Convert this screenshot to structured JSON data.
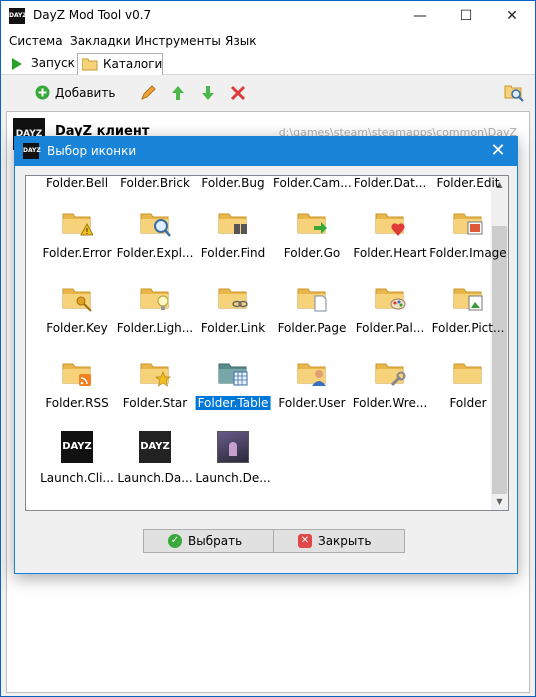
{
  "app": {
    "title": "DayZ Mod Tool  v0.7",
    "icon_text": "DAYZ"
  },
  "menu": [
    "Система",
    "Закладки",
    "Инструменты",
    "Язык"
  ],
  "tabs": [
    {
      "label": "Запуск",
      "icon": "play-icon"
    },
    {
      "label": "Каталоги",
      "icon": "folder-open-icon"
    }
  ],
  "toolbar": {
    "add_label": "Добавить",
    "icons": [
      "add-icon",
      "edit-icon",
      "arrow-up-icon",
      "arrow-down-icon",
      "delete-icon",
      "folder-search-icon"
    ]
  },
  "main_list": {
    "row_title": "DayZ клиент",
    "row_path": "d:\\games\\steam\\steamapps\\common\\DayZ"
  },
  "dialog": {
    "title": "Выбор иконки",
    "top_row": [
      "Folder.Bell",
      "Folder.Brick",
      "Folder.Bug",
      "Folder.Cam...",
      "Folder.Dat...",
      "Folder.Edit"
    ],
    "rows": [
      [
        "Folder.Error",
        "Folder.Expl...",
        "Folder.Find",
        "Folder.Go",
        "Folder.Heart",
        "Folder.Image"
      ],
      [
        "Folder.Key",
        "Folder.Ligh...",
        "Folder.Link",
        "Folder.Page",
        "Folder.Pal...",
        "Folder.Pict..."
      ],
      [
        "Folder.RSS",
        "Folder.Star",
        "Folder.Table",
        "Folder.User",
        "Folder.Wre...",
        "Folder"
      ],
      [
        "Launch.Cli...",
        "Launch.Da...",
        "Launch.De..."
      ]
    ],
    "selected": "Folder.Table",
    "select_label": "Выбрать",
    "close_label": "Закрыть"
  },
  "colors": {
    "accent": "#1883d7",
    "selection": "#0078d7",
    "folder": "#f6d27a"
  }
}
